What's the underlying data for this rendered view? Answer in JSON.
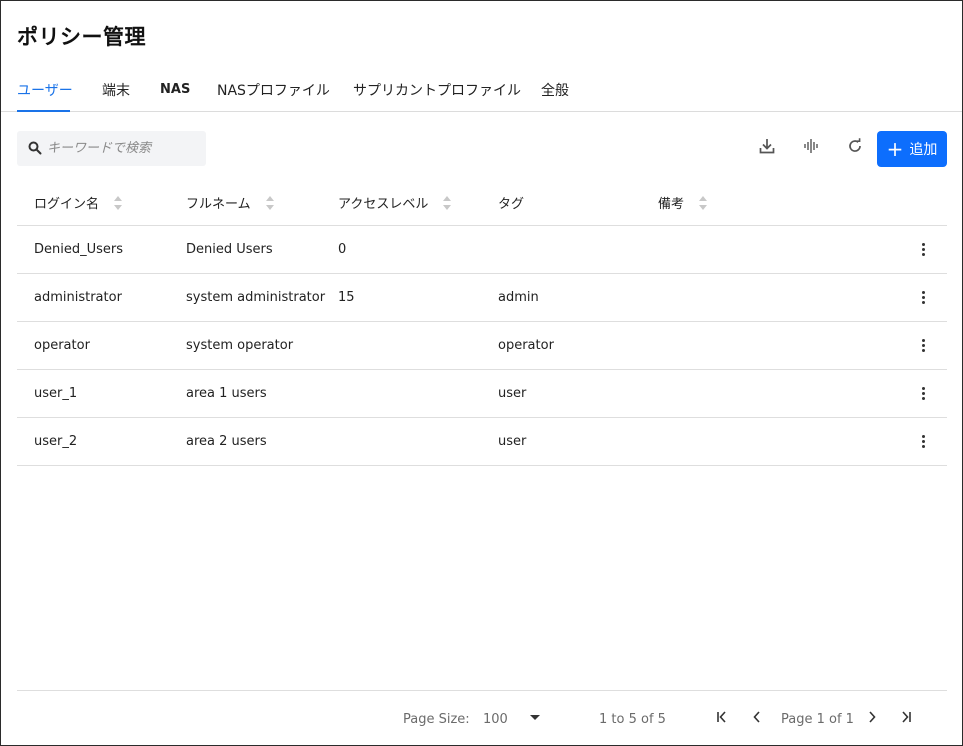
{
  "page": {
    "title": "ポリシー管理"
  },
  "tabs": [
    {
      "label": "ユーザー",
      "active": true
    },
    {
      "label": "端末"
    },
    {
      "label": "NAS"
    },
    {
      "label": "NASプロファイル"
    },
    {
      "label": "サプリカントプロファイル"
    },
    {
      "label": "全般"
    }
  ],
  "toolbar": {
    "search_placeholder": "キーワードで検索",
    "search_value": "",
    "icons": [
      "download-icon",
      "waveform-icon",
      "refresh-icon"
    ],
    "add_label": "追加",
    "accent_color": "#0d6efd"
  },
  "table": {
    "columns": [
      "ログイン名",
      "フルネーム",
      "アクセスレベル",
      "タグ",
      "備考"
    ],
    "rows": [
      {
        "login": "Denied_Users",
        "fullname": "Denied Users",
        "level": "0",
        "tag": "",
        "note": ""
      },
      {
        "login": "administrator",
        "fullname": "system administrator",
        "level": "15",
        "tag": "admin",
        "note": ""
      },
      {
        "login": "operator",
        "fullname": "system operator",
        "level": "",
        "tag": "operator",
        "note": ""
      },
      {
        "login": "user_1",
        "fullname": "area 1 users",
        "level": "",
        "tag": "user",
        "note": ""
      },
      {
        "login": "user_2",
        "fullname": "area 2 users",
        "level": "",
        "tag": "user",
        "note": ""
      }
    ]
  },
  "pagination": {
    "page_size_label": "Page Size:",
    "page_size_value": "100",
    "range_text": "1 to 5 of 5",
    "page_text": "Page 1 of 1"
  }
}
